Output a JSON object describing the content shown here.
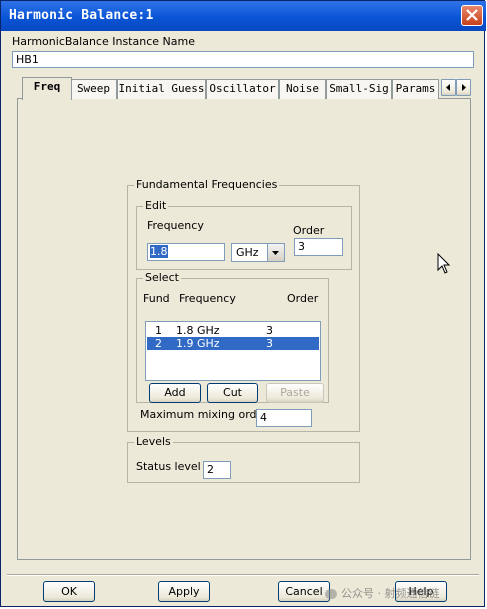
{
  "window": {
    "title": "Harmonic Balance:1"
  },
  "instance": {
    "label": "HarmonicBalance Instance Name",
    "value": "HB1"
  },
  "tabs": [
    {
      "label": "Freq"
    },
    {
      "label": "Sweep"
    },
    {
      "label": "Initial Guess"
    },
    {
      "label": "Oscillator"
    },
    {
      "label": "Noise"
    },
    {
      "label": "Small-Sig"
    },
    {
      "label": "Params"
    }
  ],
  "fundamental": {
    "title": "Fundamental Frequencies",
    "edit": {
      "title": "Edit",
      "frequency_label": "Frequency",
      "frequency_value": "1.8",
      "unit": "GHz",
      "order_label": "Order",
      "order_value": "3"
    },
    "select": {
      "title": "Select",
      "headers": {
        "fund": "Fund",
        "frequency": "Frequency",
        "order": "Order"
      },
      "rows": [
        {
          "fund": "1",
          "frequency": "1.8 GHz",
          "order": "3"
        },
        {
          "fund": "2",
          "frequency": "1.9 GHz",
          "order": "3"
        }
      ],
      "buttons": {
        "add": "Add",
        "cut": "Cut",
        "paste": "Paste"
      }
    },
    "max_mixing_label": "Maximum mixing order",
    "max_mixing_value": "4"
  },
  "levels": {
    "title": "Levels",
    "status_label": "Status level",
    "status_value": "2"
  },
  "footer": {
    "ok": "OK",
    "apply": "Apply",
    "cancel": "Cancel",
    "help": "Help"
  },
  "watermark": "公众号 · 射频通信链",
  "colors": {
    "titlebar": "#0a55d6",
    "selection": "#316ac5",
    "dialog_bg": "#ece9d8"
  }
}
